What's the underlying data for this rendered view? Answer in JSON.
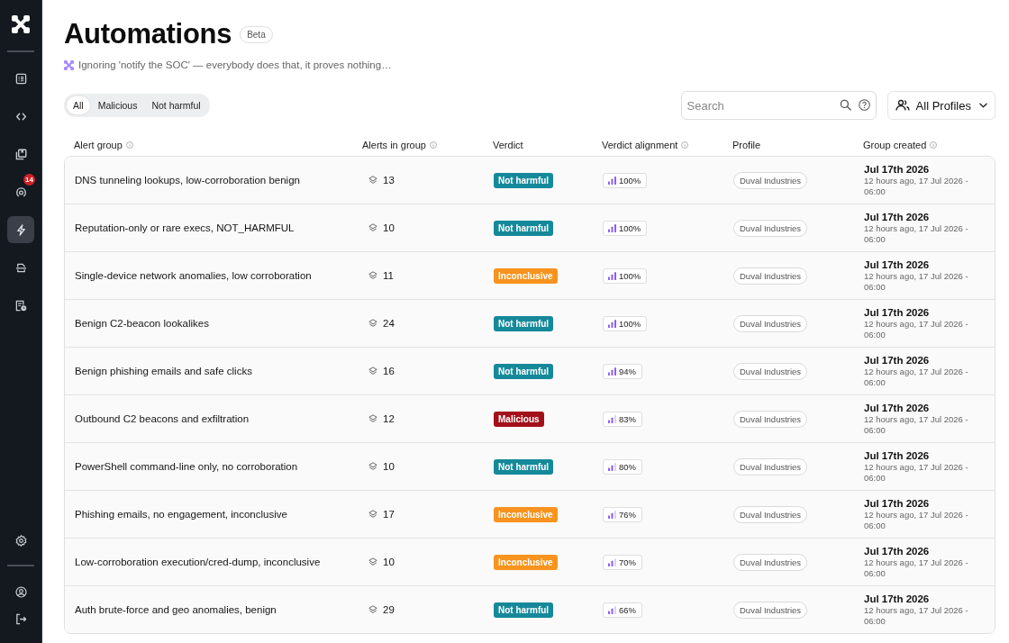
{
  "sidebar": {
    "items": [
      {
        "selected": false
      },
      {
        "selected": false
      },
      {
        "selected": false
      },
      {
        "selected": false,
        "badge": "14"
      },
      {
        "selected": true
      },
      {
        "selected": false
      },
      {
        "selected": false
      }
    ]
  },
  "header": {
    "title": "Automations",
    "badge": "Beta",
    "subtitle": "Ignoring 'notify the SOC' — everybody does that, it proves nothing…"
  },
  "filters": [
    {
      "label": "All",
      "selected": true
    },
    {
      "label": "Malicious",
      "selected": false
    },
    {
      "label": "Not harmful",
      "selected": false
    }
  ],
  "search": {
    "placeholder": "Search"
  },
  "profile_filter": {
    "label": "All Profiles"
  },
  "table": {
    "columns": [
      {
        "label": "Alert group",
        "info": true
      },
      {
        "label": "Alerts in group",
        "info": true
      },
      {
        "label": "Verdict",
        "info": false
      },
      {
        "label": "Verdict alignment",
        "info": true
      },
      {
        "label": "Profile",
        "info": false
      },
      {
        "label": "Group created",
        "info": true
      }
    ],
    "rows": [
      {
        "alert_group": "DNS tunneling lookups, low-corroboration benign",
        "alerts": "13",
        "verdict": {
          "label": "Not harmful",
          "color": "#15899a"
        },
        "alignment": {
          "reading": "100%",
          "bars": [
            {
              "lit": true
            },
            {
              "lit": true
            },
            {
              "lit": true
            }
          ]
        },
        "profile": "Duval Industries",
        "created": {
          "date": "Jul 17th 2026",
          "detail": "12 hours ago, 17 Jul 2026 - 06:00"
        }
      },
      {
        "alert_group": "Reputation-only or rare execs, NOT_HARMFUL",
        "alerts": "10",
        "verdict": {
          "label": "Not harmful",
          "color": "#15899a"
        },
        "alignment": {
          "reading": "100%",
          "bars": [
            {
              "lit": true
            },
            {
              "lit": true
            },
            {
              "lit": true
            }
          ]
        },
        "profile": "Duval Industries",
        "created": {
          "date": "Jul 17th 2026",
          "detail": "12 hours ago, 17 Jul 2026 - 06:00"
        }
      },
      {
        "alert_group": "Single-device network anomalies, low corroboration",
        "alerts": "11",
        "verdict": {
          "label": "Inconclusive",
          "color": "#f7931e"
        },
        "alignment": {
          "reading": "100%",
          "bars": [
            {
              "lit": true
            },
            {
              "lit": true
            },
            {
              "lit": true
            }
          ]
        },
        "profile": "Duval Industries",
        "created": {
          "date": "Jul 17th 2026",
          "detail": "12 hours ago, 17 Jul 2026 - 06:00"
        }
      },
      {
        "alert_group": "Benign C2-beacon lookalikes",
        "alerts": "24",
        "verdict": {
          "label": "Not harmful",
          "color": "#15899a"
        },
        "alignment": {
          "reading": "100%",
          "bars": [
            {
              "lit": true
            },
            {
              "lit": true
            },
            {
              "lit": true
            }
          ]
        },
        "profile": "Duval Industries",
        "created": {
          "date": "Jul 17th 2026",
          "detail": "12 hours ago, 17 Jul 2026 - 06:00"
        }
      },
      {
        "alert_group": "Benign phishing emails and safe clicks",
        "alerts": "16",
        "verdict": {
          "label": "Not harmful",
          "color": "#15899a"
        },
        "alignment": {
          "reading": "94%",
          "bars": [
            {
              "lit": true
            },
            {
              "lit": true
            },
            {
              "lit": true
            }
          ]
        },
        "profile": "Duval Industries",
        "created": {
          "date": "Jul 17th 2026",
          "detail": "12 hours ago, 17 Jul 2026 - 06:00"
        }
      },
      {
        "alert_group": "Outbound C2 beacons and exfiltration",
        "alerts": "12",
        "verdict": {
          "label": "Malicious",
          "color": "#a3101a"
        },
        "alignment": {
          "reading": "83%",
          "bars": [
            {
              "lit": true
            },
            {
              "lit": true
            },
            {
              "lit": false
            }
          ]
        },
        "profile": "Duval Industries",
        "created": {
          "date": "Jul 17th 2026",
          "detail": "12 hours ago, 17 Jul 2026 - 06:00"
        }
      },
      {
        "alert_group": "PowerShell command-line only, no corroboration",
        "alerts": "10",
        "verdict": {
          "label": "Not harmful",
          "color": "#15899a"
        },
        "alignment": {
          "reading": "80%",
          "bars": [
            {
              "lit": true
            },
            {
              "lit": true
            },
            {
              "lit": false
            }
          ]
        },
        "profile": "Duval Industries",
        "created": {
          "date": "Jul 17th 2026",
          "detail": "12 hours ago, 17 Jul 2026 - 06:00"
        }
      },
      {
        "alert_group": "Phishing emails, no engagement, inconclusive",
        "alerts": "17",
        "verdict": {
          "label": "Inconclusive",
          "color": "#f7931e"
        },
        "alignment": {
          "reading": "76%",
          "bars": [
            {
              "lit": true
            },
            {
              "lit": true
            },
            {
              "lit": false
            }
          ]
        },
        "profile": "Duval Industries",
        "created": {
          "date": "Jul 17th 2026",
          "detail": "12 hours ago, 17 Jul 2026 - 06:00"
        }
      },
      {
        "alert_group": "Low-corroboration execution/cred-dump, inconclusive",
        "alerts": "10",
        "verdict": {
          "label": "Inconclusive",
          "color": "#f7931e"
        },
        "alignment": {
          "reading": "70%",
          "bars": [
            {
              "lit": true
            },
            {
              "lit": true
            },
            {
              "lit": false
            }
          ]
        },
        "profile": "Duval Industries",
        "created": {
          "date": "Jul 17th 2026",
          "detail": "12 hours ago, 17 Jul 2026 - 06:00"
        }
      },
      {
        "alert_group": "Auth brute-force and geo anomalies, benign",
        "alerts": "29",
        "verdict": {
          "label": "Not harmful",
          "color": "#15899a"
        },
        "alignment": {
          "reading": "66%",
          "bars": [
            {
              "lit": true
            },
            {
              "lit": true
            },
            {
              "lit": false
            }
          ]
        },
        "profile": "Duval Industries",
        "created": {
          "date": "Jul 17th 2026",
          "detail": "12 hours ago, 17 Jul 2026 - 06:00"
        }
      }
    ]
  }
}
